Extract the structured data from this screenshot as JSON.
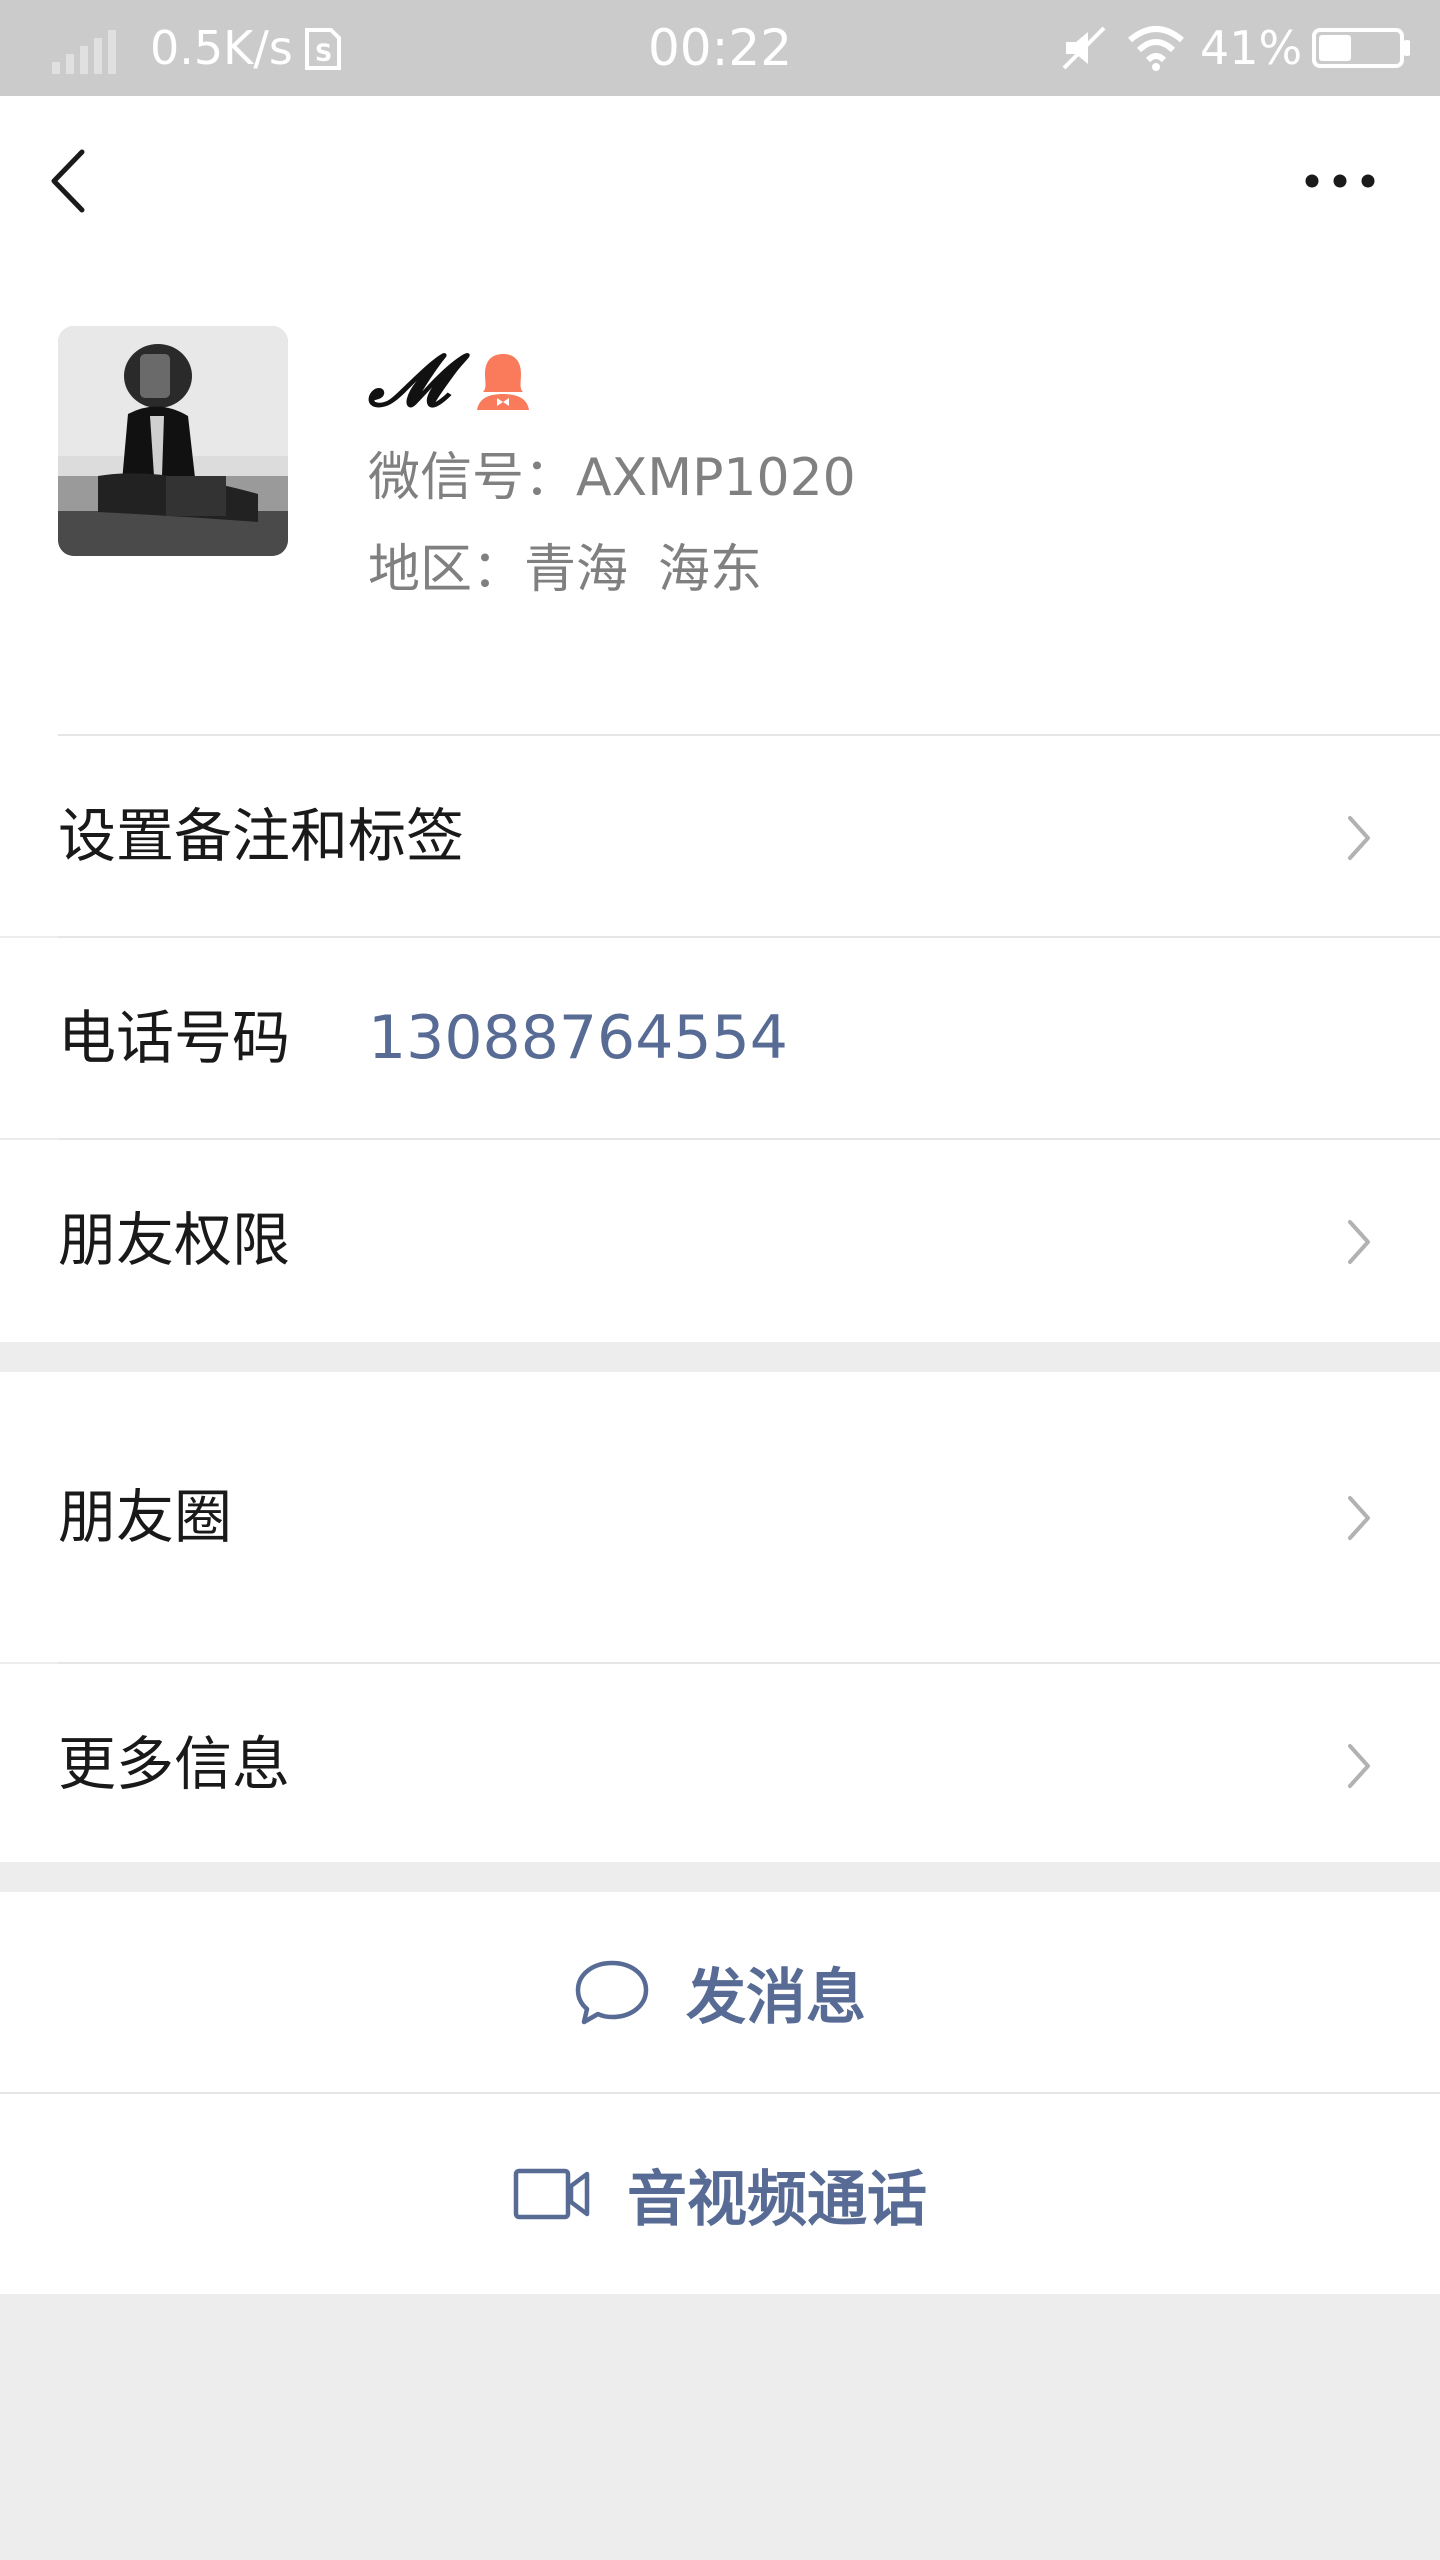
{
  "status_bar": {
    "net_speed": "0.5K/s",
    "time": "00:22",
    "battery_percent": "41%",
    "battery_level": 0.41,
    "icons": [
      "signal-icon",
      "sim-icon",
      "mute-icon",
      "wifi-icon",
      "battery-icon"
    ]
  },
  "nav": {
    "icons": [
      "back-arrow-icon",
      "more-dots-icon"
    ]
  },
  "profile": {
    "name": "𝓜",
    "wechat_id_label": "微信号：",
    "wechat_id": "AXMP1020",
    "region_label": "地区：",
    "region_province": "青海",
    "region_city": "海东",
    "gender_icon": "female-gender-icon",
    "gender_color": "#fa7a5c"
  },
  "rows": {
    "remark_tags": "设置备注和标签",
    "phone_label": "电话号码",
    "phone_value": "13088764554",
    "friend_permissions": "朋友权限",
    "moments": "朋友圈",
    "more_info": "更多信息"
  },
  "actions": {
    "send_message": "发消息",
    "av_call": "音视频通话"
  },
  "colors": {
    "link_blue": "#576b95",
    "background": "#ededed",
    "status_bar": "#cbcbcb"
  }
}
